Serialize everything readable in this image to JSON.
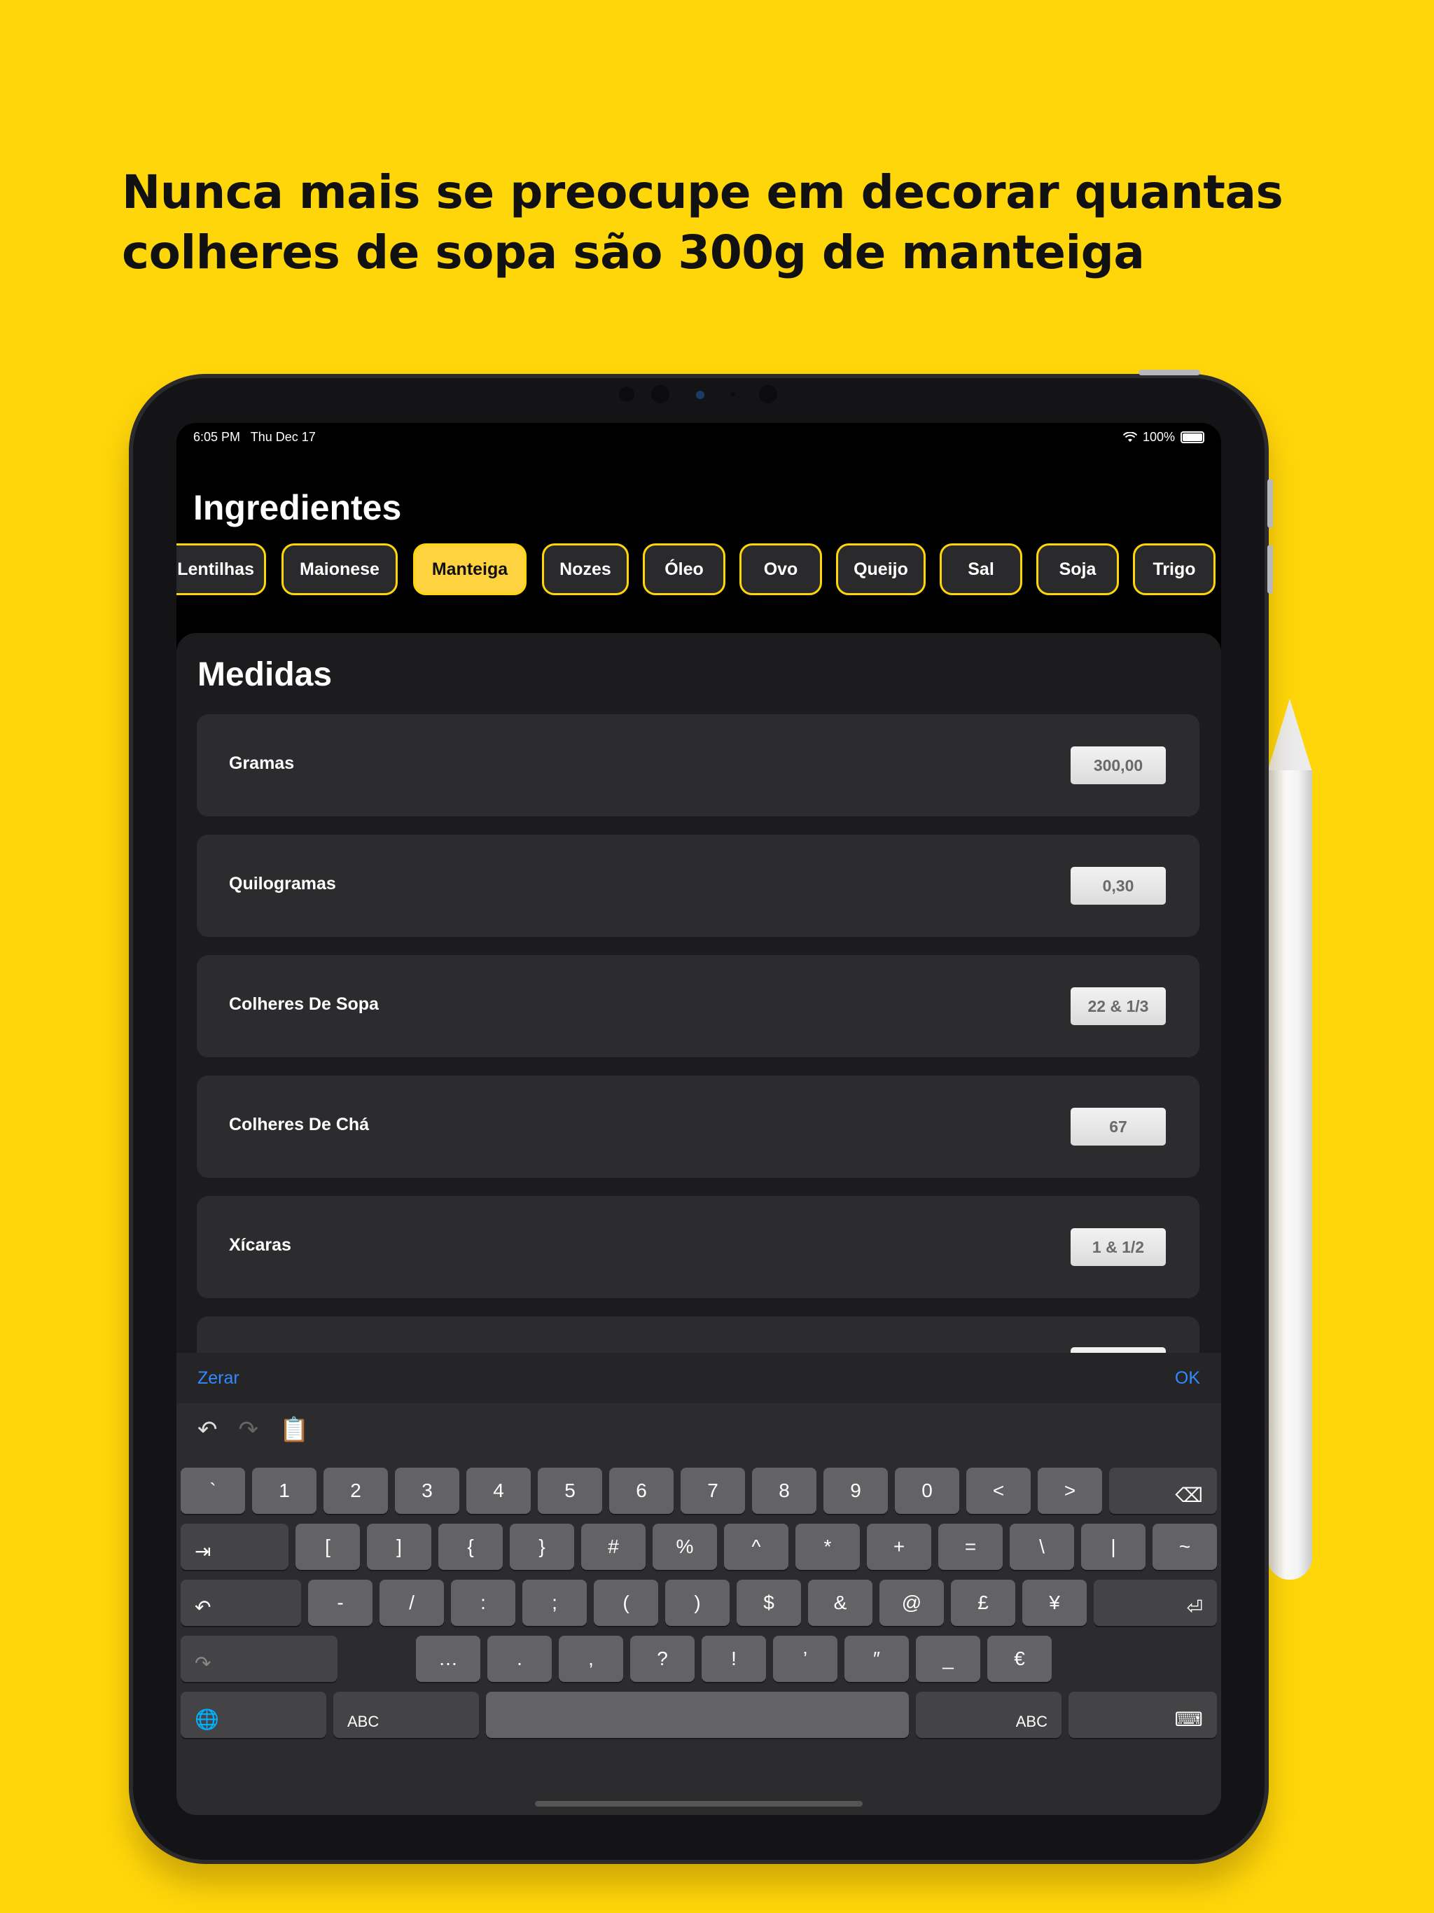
{
  "headline": {
    "line1": "Nunca mais se preocupe em decorar quantas",
    "line2": "colheres de sopa são 300g de manteiga"
  },
  "status_bar": {
    "time": "6:05 PM",
    "date": "Thu Dec 17",
    "battery": "100%"
  },
  "screen_title": "Ingredientes",
  "ingredients": [
    "Lentilhas",
    "Maionese",
    "Manteiga",
    "Nozes",
    "Óleo",
    "Ovo",
    "Queijo",
    "Sal",
    "Soja",
    "Trigo"
  ],
  "selected_ingredient": "Manteiga",
  "measures": {
    "title": "Medidas",
    "rows": [
      {
        "label": "Gramas",
        "value": "300,00"
      },
      {
        "label": "Quilogramas",
        "value": "0,30"
      },
      {
        "label": "Colheres De Sopa",
        "value": "22 & 1/3"
      },
      {
        "label": "Colheres De Chá",
        "value": "67"
      },
      {
        "label": "Xícaras",
        "value": "1 & 1/2"
      }
    ]
  },
  "keyboard_toolbar": {
    "left": "Zerar",
    "right": "OK"
  },
  "keyboard": {
    "row1": [
      "`",
      "1",
      "2",
      "3",
      "4",
      "5",
      "6",
      "7",
      "8",
      "9",
      "0",
      "<",
      ">"
    ],
    "row2": [
      "[",
      "]",
      "{",
      "}",
      "#",
      "%",
      "^",
      "*",
      "+",
      "=",
      "\\",
      "|",
      "~"
    ],
    "row3": [
      "-",
      "/",
      ":",
      ";",
      "(",
      ")",
      "$",
      "&",
      "@",
      "£",
      "¥"
    ],
    "row4": [
      "…",
      ".",
      ",",
      "?",
      "!",
      "’",
      "″",
      "_",
      "€"
    ],
    "abc_left": "ABC",
    "abc_right": "ABC"
  },
  "colors": {
    "background": "#FFD60A",
    "accent": "#FFD340",
    "link": "#2F8BFF"
  }
}
